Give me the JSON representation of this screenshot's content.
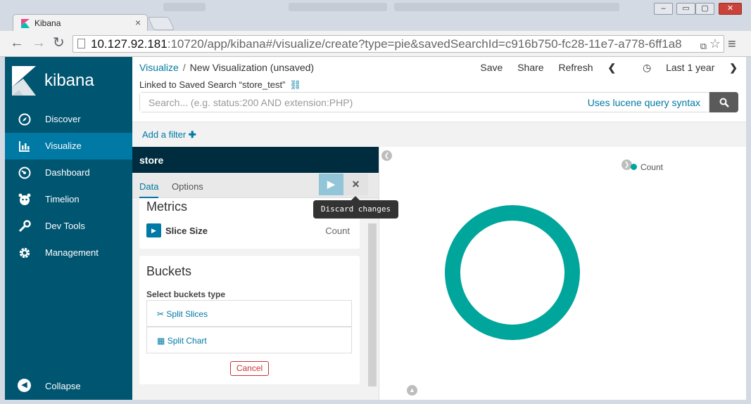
{
  "browser": {
    "tab_title": "Kibana",
    "tab_close": "×",
    "url_host": "10.127.92.181",
    "url_path": ":10720/app/kibana#/visualize/create?type=pie&savedSearchId=c916b750-fc28-11e7-a778-6ff1a8",
    "back": "←",
    "forward": "→",
    "reload": "↻",
    "menu": "≡",
    "star": "☆"
  },
  "sidebar": {
    "brand": "kibana",
    "items": [
      {
        "label": "Discover",
        "icon": "compass-icon"
      },
      {
        "label": "Visualize",
        "icon": "bar-chart-icon"
      },
      {
        "label": "Dashboard",
        "icon": "gauge-icon"
      },
      {
        "label": "Timelion",
        "icon": "timelion-icon"
      },
      {
        "label": "Dev Tools",
        "icon": "wrench-icon"
      },
      {
        "label": "Management",
        "icon": "gear-icon"
      }
    ],
    "collapse": "Collapse",
    "active": "Visualize"
  },
  "header": {
    "breadcrumb_root": "Visualize",
    "breadcrumb_sep": "/",
    "breadcrumb_current": "New Visualization (unsaved)",
    "save": "Save",
    "share": "Share",
    "refresh": "Refresh",
    "time_range": "Last 1 year",
    "linked_search": "Linked to Saved Search “store_test”"
  },
  "search": {
    "placeholder": "Search... (e.g. status:200 AND extension:PHP)",
    "syntax_link": "Uses lucene query syntax"
  },
  "filters": {
    "add_filter": "Add a filter"
  },
  "editor": {
    "index_title": "store",
    "tabs": [
      "Data",
      "Options"
    ],
    "active_tab": "Data",
    "tooltip": "Discard changes",
    "metrics_title": "Metrics",
    "metric_label": "Slice Size",
    "metric_agg": "Count",
    "buckets_title": "Buckets",
    "buckets_select": "Select buckets type",
    "bucket_options": [
      "Split Slices",
      "Split Chart"
    ],
    "cancel": "Cancel"
  },
  "chart_data": {
    "type": "pie",
    "categories": [
      "Count"
    ],
    "values": [
      100
    ],
    "donut": true,
    "legend": [
      "Count"
    ],
    "legend_position": "top-right",
    "colors": {
      "series": "#00a69b"
    }
  },
  "colors": {
    "sidebar": "#005571",
    "sidebar_active": "#0079a5",
    "editor_header": "#002c3f",
    "link": "#0079a5"
  }
}
